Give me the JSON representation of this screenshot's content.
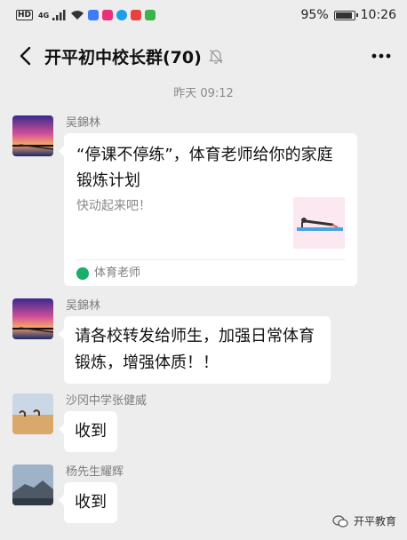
{
  "status_bar": {
    "hd": "HD",
    "network": "4G",
    "battery_percent": "95%",
    "battery_level": 0.95,
    "time": "10:26"
  },
  "nav": {
    "title": "开平初中校长群(70)",
    "back_icon": "chevron-left-icon",
    "mute_icon": "bell-off-icon",
    "more_icon": "more-dots-icon"
  },
  "timestamp": "昨天 09:12",
  "messages": [
    {
      "sender": "吴錦林",
      "type": "link_card",
      "card": {
        "title": "“停课不停练”，体育老师给你的家庭锻炼计划",
        "desc": "快动起来吧！",
        "source": "体育老师"
      }
    },
    {
      "sender": "吴錦林",
      "type": "text",
      "lines": [
        "请各校转发给师生，加强日常体育",
        "锻炼，增强体质！！"
      ]
    },
    {
      "sender": "沙冈中学张健威",
      "type": "text",
      "text": "收到"
    },
    {
      "sender": "杨先生耀辉",
      "type": "text",
      "text": "收到"
    }
  ],
  "watermark": "开平教育"
}
